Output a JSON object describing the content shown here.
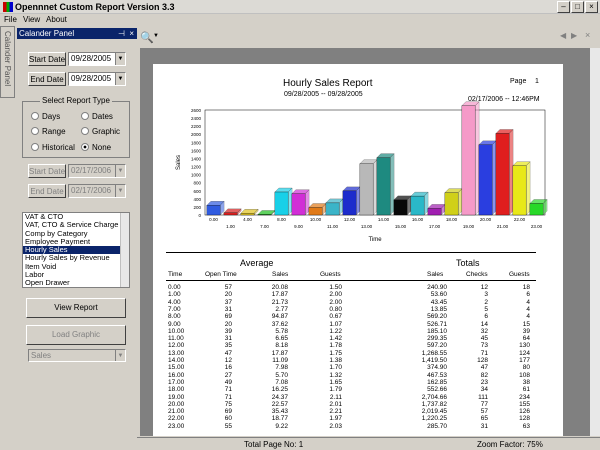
{
  "window": {
    "title": "Opennnet Custom Report Version 3.3"
  },
  "menu": [
    "File",
    "View",
    "About"
  ],
  "side_tab": "Calander Panel",
  "panel": {
    "title": "Calander Panel",
    "start_label": "Start Date",
    "start_value": "09/28/2005",
    "end_label": "End Date",
    "end_value": "09/28/2005",
    "group_title": "Select Report Type",
    "radios": [
      "Days",
      "Dates",
      "Range",
      "Graphic",
      "Historical",
      "None"
    ],
    "dis_start_label": "Start Date",
    "dis_start_value": "02/17/2006",
    "dis_end_label": "End Date",
    "dis_end_value": "02/17/2006",
    "reports": [
      "VAT & CTO",
      "VAT, CTO & Service Charge",
      "Comp by Category",
      "Employee Payment",
      "Hourly Sales",
      "Hourly Sales by Revenue",
      "Item Void",
      "Labor",
      "Open Drawer"
    ],
    "view_report": "View Report",
    "load_graphic": "Load Graphic",
    "graphic_select": "Sales"
  },
  "report": {
    "title": "Hourly Sales Report",
    "range": "09/28/2005 -- 09/28/2005",
    "page_label": "Page",
    "page_no": "1",
    "printed": "02/17/2006 -- 12:46PM",
    "avg_title": "Average",
    "tot_title": "Totals",
    "headers": {
      "time": "Time",
      "open": "Open Time",
      "sales": "Sales",
      "guests": "Guests",
      "tsales": "Sales",
      "checks": "Checks",
      "tguests": "Guests"
    },
    "rows": [
      [
        "0.00",
        "57",
        "20.08",
        "1.50",
        "240.90",
        "12",
        "18"
      ],
      [
        "1.00",
        "20",
        "17.87",
        "2.00",
        "53.60",
        "3",
        "6"
      ],
      [
        "4.00",
        "37",
        "21.73",
        "2.00",
        "43.45",
        "2",
        "4"
      ],
      [
        "7.00",
        "31",
        "2.77",
        "0.80",
        "13.85",
        "5",
        "4"
      ],
      [
        "8.00",
        "69",
        "94.87",
        "0.67",
        "569.20",
        "6",
        "4"
      ],
      [
        "9.00",
        "20",
        "37.62",
        "1.07",
        "526.71",
        "14",
        "15"
      ],
      [
        "10.00",
        "39",
        "5.78",
        "1.22",
        "185.10",
        "32",
        "39"
      ],
      [
        "11.00",
        "31",
        "6.65",
        "1.42",
        "299.35",
        "45",
        "64"
      ],
      [
        "12.00",
        "35",
        "8.18",
        "1.78",
        "597.20",
        "73",
        "130"
      ],
      [
        "13.00",
        "47",
        "17.87",
        "1.75",
        "1,268.55",
        "71",
        "124"
      ],
      [
        "14.00",
        "12",
        "11.09",
        "1.38",
        "1,419.50",
        "128",
        "177"
      ],
      [
        "15.00",
        "16",
        "7.98",
        "1.70",
        "374.90",
        "47",
        "80"
      ],
      [
        "16.00",
        "27",
        "5.70",
        "1.32",
        "467.53",
        "82",
        "108"
      ],
      [
        "17.00",
        "49",
        "7.08",
        "1.65",
        "162.85",
        "23",
        "38"
      ],
      [
        "18.00",
        "71",
        "16.25",
        "1.79",
        "552.66",
        "34",
        "61"
      ],
      [
        "19.00",
        "71",
        "24.37",
        "2.11",
        "2,704.66",
        "111",
        "234"
      ],
      [
        "20.00",
        "75",
        "22.57",
        "2.01",
        "1,737.82",
        "77",
        "155"
      ],
      [
        "21.00",
        "69",
        "35.43",
        "2.21",
        "2,019.45",
        "57",
        "126"
      ],
      [
        "22.00",
        "60",
        "18.77",
        "1.97",
        "1,220.25",
        "65",
        "128"
      ],
      [
        "23.00",
        "55",
        "9.22",
        "2.03",
        "285.70",
        "31",
        "63"
      ]
    ]
  },
  "status": {
    "total": "Total Page No: 1",
    "zoom": "Zoom Factor: 75%"
  },
  "chart_data": {
    "type": "bar",
    "ylabel": "Sales",
    "xlabel": "Time",
    "ylim": [
      0,
      2600
    ],
    "yticks": [
      "0",
      "200",
      "400",
      "600",
      "800",
      "1000",
      "1200",
      "1400",
      "1600",
      "1800",
      "2000",
      "2200",
      "2400",
      "2600"
    ],
    "categories": [
      "0.00",
      "1.00",
      "4.00",
      "7.00",
      "8.00",
      "9.00",
      "10.00",
      "11.00",
      "12.00",
      "13.00",
      "14.00",
      "15.00",
      "16.00",
      "17.00",
      "18.00",
      "19.00",
      "20.00",
      "21.00",
      "22.00",
      "23.00"
    ],
    "values": [
      240.9,
      53.6,
      43.45,
      13.85,
      569.2,
      526.71,
      185.1,
      299.35,
      597.2,
      1268.55,
      1419.5,
      374.9,
      467.53,
      162.85,
      552.66,
      2704.66,
      1737.82,
      2019.45,
      1220.25,
      285.7
    ],
    "colors": [
      "#2f5be0",
      "#d81e1e",
      "#e0c21e",
      "#1ec01e",
      "#18d0e8",
      "#d12ed6",
      "#e07a18",
      "#3bb4c8",
      "#1d2ccc",
      "#b8b8b8",
      "#1e8a80",
      "#080808",
      "#2ab8c8",
      "#a01eb0",
      "#d0d018",
      "#f59ac8",
      "#2a3ee0",
      "#e01e1e",
      "#e8e818",
      "#28d828"
    ]
  }
}
